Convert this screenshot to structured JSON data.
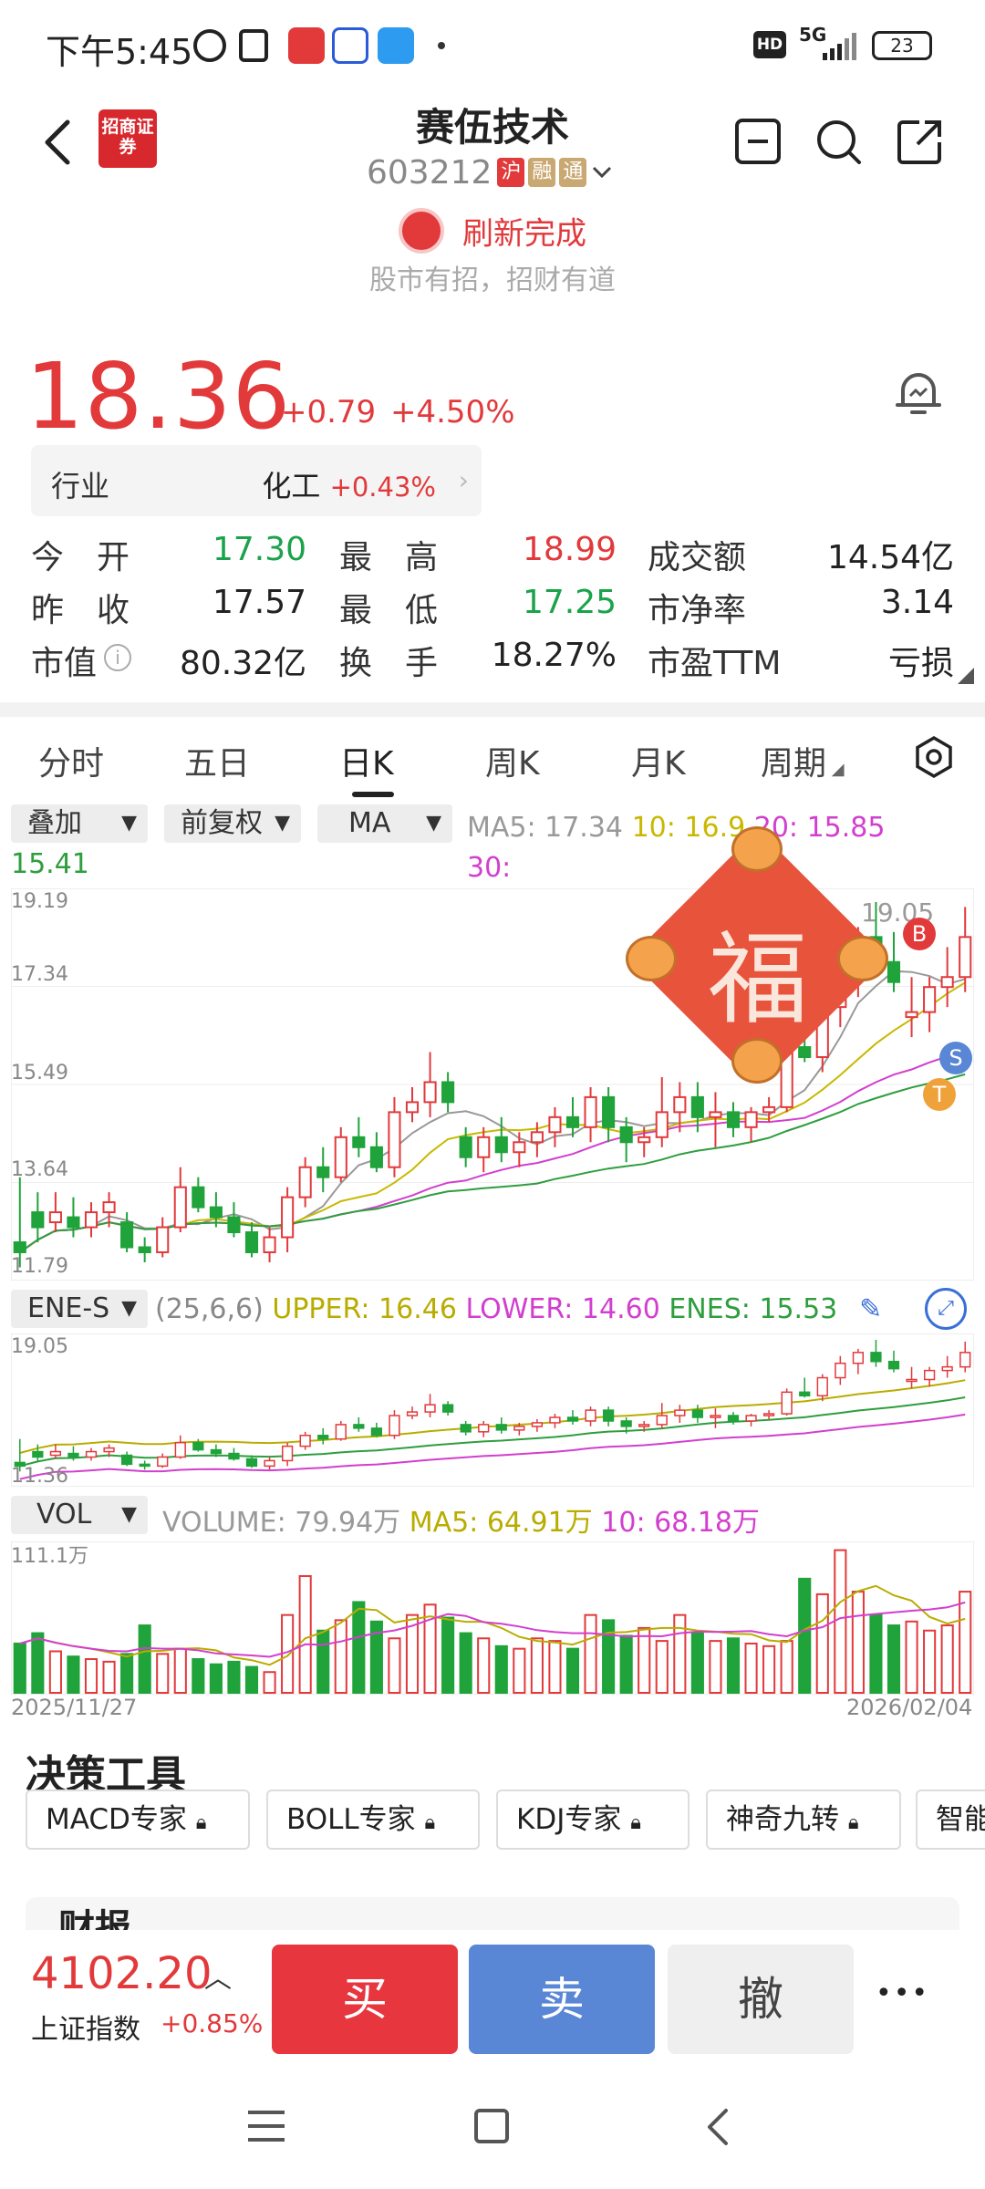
{
  "status_bar": {
    "time": "下午5:45",
    "network": "5G",
    "battery": "23"
  },
  "header": {
    "broker_logo_text": "招商证券",
    "stock_name": "赛伍技术",
    "stock_code": "603212",
    "tags": [
      "沪",
      "融",
      "通"
    ],
    "refresh_text": "刷新完成",
    "slogan": "股市有招，招财有道"
  },
  "quote": {
    "price": "18.36",
    "change": "+0.79",
    "change_pct": "+4.50%",
    "industry_label": "行业",
    "industry_name": "化工",
    "industry_change": "+0.43%",
    "stats": [
      {
        "label": "今　开",
        "value": "17.30",
        "color": "green"
      },
      {
        "label": "最　高",
        "value": "18.99",
        "color": "red"
      },
      {
        "label": "成交额",
        "value": "14.54亿",
        "color": "black"
      },
      {
        "label": "昨　收",
        "value": "17.57",
        "color": "black"
      },
      {
        "label": "最　低",
        "value": "17.25",
        "color": "green"
      },
      {
        "label": "市净率",
        "value": "3.14",
        "color": "black"
      },
      {
        "label": "市值",
        "value": "80.32亿",
        "color": "black"
      },
      {
        "label": "换　手",
        "value": "18.27%",
        "color": "black"
      },
      {
        "label": "市盈TTM",
        "value": "亏损",
        "color": "black"
      }
    ]
  },
  "tabs": [
    "分时",
    "五日",
    "日K",
    "周K",
    "月K",
    "周期"
  ],
  "active_tab": "日K",
  "chart_controls": {
    "overlay": "叠加",
    "adjust": "前复权",
    "indicator": "MA",
    "ma_legend": [
      {
        "text": "MA5: 17.34",
        "color": "#999999"
      },
      {
        "text": "10: 16.9",
        "color": "#c9b800"
      },
      {
        "text": "20: 15.85",
        "color": "#d23fcf"
      },
      {
        "text": "30:",
        "color": "#d23fcf"
      },
      {
        "text": "15.41",
        "color": "#2e9e3e"
      }
    ]
  },
  "chart_data": [
    {
      "type": "candlestick",
      "title": "日K",
      "y_ticks": [
        "19.19",
        "17.34",
        "15.49",
        "13.64",
        "11.79"
      ],
      "ylim": [
        11.79,
        19.19
      ],
      "high_label": "19.05",
      "markers": [
        "B",
        "S",
        "T"
      ],
      "candles": [
        [
          12.3,
          13.6,
          11.8,
          12.1
        ],
        [
          12.9,
          13.3,
          12.3,
          12.6
        ],
        [
          12.7,
          13.3,
          12.5,
          12.9
        ],
        [
          12.8,
          13.2,
          12.4,
          12.6
        ],
        [
          12.6,
          13.1,
          12.4,
          12.9
        ],
        [
          12.9,
          13.3,
          12.6,
          13.1
        ],
        [
          12.7,
          12.9,
          12.1,
          12.2
        ],
        [
          12.2,
          12.4,
          11.9,
          12.1
        ],
        [
          12.1,
          12.8,
          12.0,
          12.6
        ],
        [
          12.6,
          13.8,
          12.5,
          13.4
        ],
        [
          13.4,
          13.6,
          12.9,
          13.0
        ],
        [
          13.0,
          13.3,
          12.6,
          12.8
        ],
        [
          12.8,
          13.1,
          12.4,
          12.5
        ],
        [
          12.5,
          12.7,
          12.0,
          12.1
        ],
        [
          12.1,
          12.6,
          11.9,
          12.4
        ],
        [
          12.4,
          13.4,
          12.1,
          13.2
        ],
        [
          13.2,
          14.0,
          13.0,
          13.8
        ],
        [
          13.8,
          14.2,
          13.3,
          13.6
        ],
        [
          13.6,
          14.6,
          13.5,
          14.4
        ],
        [
          14.4,
          14.8,
          14.0,
          14.2
        ],
        [
          14.2,
          14.5,
          13.7,
          13.8
        ],
        [
          13.8,
          15.2,
          13.6,
          14.9
        ],
        [
          14.9,
          15.4,
          14.7,
          15.1
        ],
        [
          15.1,
          16.1,
          14.8,
          15.5
        ],
        [
          15.5,
          15.7,
          14.9,
          15.1
        ],
        [
          14.4,
          14.6,
          13.8,
          14.0
        ],
        [
          14.0,
          14.6,
          13.7,
          14.4
        ],
        [
          14.4,
          14.8,
          13.9,
          14.1
        ],
        [
          14.1,
          14.5,
          13.8,
          14.3
        ],
        [
          14.3,
          14.7,
          14.0,
          14.5
        ],
        [
          14.5,
          15.0,
          14.2,
          14.8
        ],
        [
          14.8,
          15.2,
          14.4,
          14.6
        ],
        [
          14.6,
          15.4,
          14.3,
          15.2
        ],
        [
          15.2,
          15.4,
          14.3,
          14.6
        ],
        [
          14.6,
          14.8,
          13.9,
          14.3
        ],
        [
          14.3,
          14.6,
          14.0,
          14.4
        ],
        [
          14.4,
          15.6,
          14.2,
          14.9
        ],
        [
          14.9,
          15.5,
          14.5,
          15.2
        ],
        [
          15.2,
          15.5,
          14.5,
          14.8
        ],
        [
          14.8,
          15.3,
          14.2,
          14.9
        ],
        [
          14.9,
          15.1,
          14.4,
          14.6
        ],
        [
          14.6,
          15.0,
          14.3,
          14.9
        ],
        [
          14.9,
          15.2,
          14.7,
          15.0
        ],
        [
          15.0,
          16.4,
          14.9,
          16.2
        ],
        [
          16.2,
          17.0,
          15.9,
          16.0
        ],
        [
          16.0,
          17.2,
          15.7,
          17.0
        ],
        [
          17.0,
          18.2,
          16.6,
          17.8
        ],
        [
          17.8,
          18.6,
          17.2,
          18.4
        ],
        [
          18.4,
          19.1,
          17.6,
          17.9
        ],
        [
          17.9,
          18.5,
          17.3,
          17.5
        ],
        [
          16.8,
          17.6,
          16.4,
          16.9
        ],
        [
          16.9,
          17.6,
          16.5,
          17.4
        ],
        [
          17.4,
          18.2,
          17.0,
          17.6
        ],
        [
          17.6,
          19.0,
          17.3,
          18.4
        ]
      ]
    },
    {
      "type": "line",
      "title": "ENE-S",
      "params": "(25,6,6)",
      "legend": [
        {
          "text": "UPPER: 16.46",
          "color": "#b9ac00"
        },
        {
          "text": "LOWER: 14.60",
          "color": "#d23fcf"
        },
        {
          "text": "ENES: 15.53",
          "color": "#2e9e3e"
        }
      ],
      "y_ticks": [
        "19.05",
        "11.36"
      ],
      "ylim": [
        11.36,
        19.05
      ]
    },
    {
      "type": "bar",
      "title": "VOL",
      "legend": [
        {
          "text": "VOLUME: 79.94万",
          "color": "#999999"
        },
        {
          "text": "MA5: 64.91万",
          "color": "#b9ac00"
        },
        {
          "text": "10: 68.18万",
          "color": "#d23fcf"
        }
      ],
      "y_max_label": "111.1万",
      "ylim": [
        0,
        111.1
      ],
      "x_start": "2025/11/27",
      "x_end": "2026/02/04",
      "values": [
        38,
        46,
        32,
        28,
        26,
        24,
        30,
        52,
        30,
        34,
        26,
        22,
        24,
        20,
        16,
        60,
        90,
        48,
        56,
        70,
        55,
        42,
        60,
        68,
        58,
        46,
        42,
        36,
        34,
        42,
        40,
        34,
        60,
        56,
        44,
        50,
        40,
        60,
        46,
        40,
        42,
        38,
        36,
        40,
        88,
        76,
        110,
        78,
        60,
        52,
        55,
        48,
        52,
        78
      ]
    }
  ],
  "decision_tools": {
    "title": "决策工具",
    "items": [
      "MACD专家",
      "BOLL专家",
      "KDJ专家",
      "神奇九转",
      "智能"
    ]
  },
  "financial_peek": "财报",
  "bottom_bar": {
    "index_value": "4102.20",
    "index_name": "上证指数",
    "index_change": "+0.85%",
    "buy": "买",
    "sell": "卖",
    "cancel": "撤",
    "more": "•••"
  },
  "fu_decoration": "福"
}
